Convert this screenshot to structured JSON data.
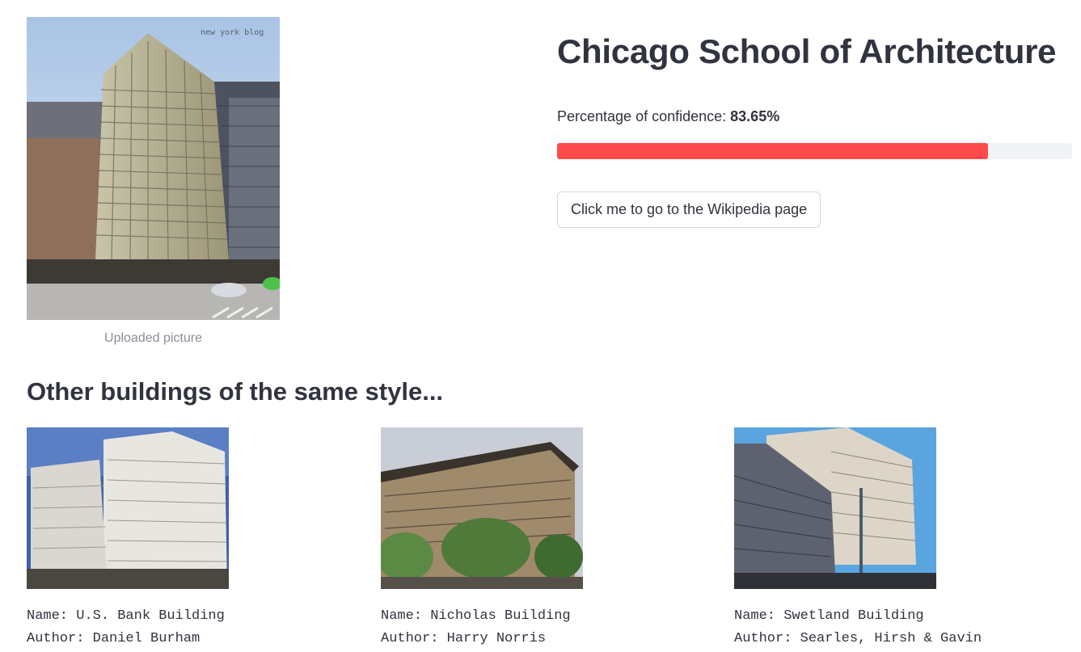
{
  "uploaded": {
    "caption": "Uploaded picture",
    "watermark": "new york blog"
  },
  "result": {
    "title": "Chicago School of Architecture",
    "confidence_label": "Percentage of confidence: ",
    "confidence_value": "83.65%",
    "confidence_fraction": 0.8365,
    "wiki_button_label": "Click me to go to the Wikipedia page"
  },
  "similar": {
    "title": "Other buildings of the same style...",
    "items": [
      {
        "name_line": "Name: U.S. Bank Building",
        "author_line": "Author: Daniel Burham"
      },
      {
        "name_line": "Name: Nicholas Building",
        "author_line": "Author: Harry Norris"
      },
      {
        "name_line": "Name: Swetland Building",
        "author_line": "Author: Searles, Hirsh & Gavin"
      }
    ]
  },
  "colors": {
    "progress_fill": "#ff4b4b",
    "progress_track": "#f0f2f6",
    "text": "#31333f",
    "caption": "#8a8d96"
  }
}
